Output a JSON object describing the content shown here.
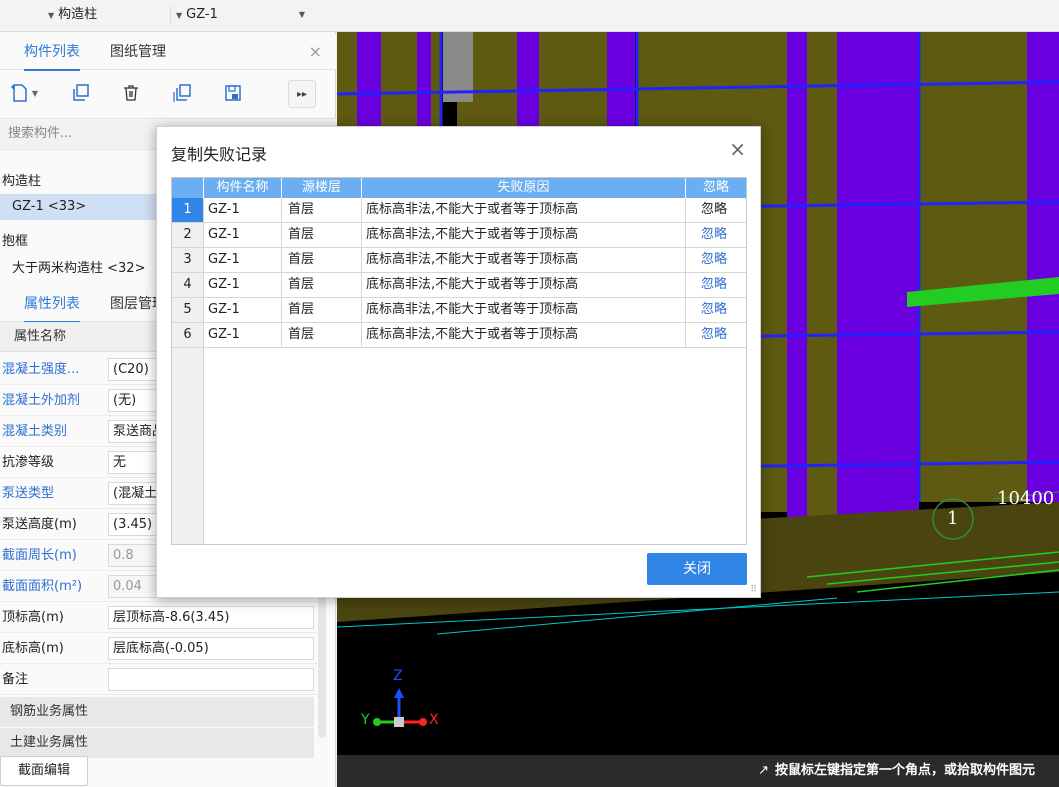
{
  "toolbar": {
    "combo1": "构造柱",
    "combo2": "GZ-1"
  },
  "left_tabs": {
    "tab1": "构件列表",
    "tab2": "图纸管理",
    "close": "×"
  },
  "search": {
    "placeholder": "搜索构件..."
  },
  "tree": {
    "group1": "构造柱",
    "item1": "GZ-1 <33>",
    "group2": "抱框",
    "item2": "大于两米构造柱 <32>"
  },
  "prop_tabs": {
    "tab1": "属性列表",
    "tab2": "图层管理"
  },
  "properties": {
    "header": "属性名称",
    "rows": [
      {
        "name": "混凝土强度...",
        "value": "(C20)"
      },
      {
        "name": "混凝土外加剂",
        "value": "(无)"
      },
      {
        "name": "混凝土类别",
        "value": "泵送商品砼"
      },
      {
        "name": "抗渗等级",
        "value": "无"
      },
      {
        "name": "泵送类型",
        "value": "(混凝土泵)"
      },
      {
        "name": "泵送高度(m)",
        "value": "(3.45)"
      },
      {
        "name": "截面周长(m)",
        "value": "0.8"
      },
      {
        "name": "截面面积(m²)",
        "value": "0.04"
      },
      {
        "name": "顶标高(m)",
        "value": "层顶标高-8.6(3.45)"
      },
      {
        "name": "底标高(m)",
        "value": "层底标高(-0.05)"
      },
      {
        "name": "备注",
        "value": ""
      }
    ],
    "group1": "钢筋业务属性",
    "group2": "土建业务属性"
  },
  "section_edit": "截面编辑",
  "viewport": {
    "label_10400": "10400",
    "label_1": "1",
    "axis_z": "Z",
    "axis_y": "Y",
    "axis_x": "X"
  },
  "status": {
    "icon": "↗",
    "text": "按鼠标左键指定第一个角点，或拾取构件图元"
  },
  "dialog": {
    "title": "复制失败记录",
    "close": "×",
    "columns": [
      "构件名称",
      "源楼层",
      "失败原因",
      "忽略"
    ],
    "rows": [
      {
        "num": "1",
        "name": "GZ-1",
        "floor": "首层",
        "reason": "底标高非法,不能大于或者等于顶标高",
        "ignore": "忽略"
      },
      {
        "num": "2",
        "name": "GZ-1",
        "floor": "首层",
        "reason": "底标高非法,不能大于或者等于顶标高",
        "ignore": "忽略"
      },
      {
        "num": "3",
        "name": "GZ-1",
        "floor": "首层",
        "reason": "底标高非法,不能大于或者等于顶标高",
        "ignore": "忽略"
      },
      {
        "num": "4",
        "name": "GZ-1",
        "floor": "首层",
        "reason": "底标高非法,不能大于或者等于顶标高",
        "ignore": "忽略"
      },
      {
        "num": "5",
        "name": "GZ-1",
        "floor": "首层",
        "reason": "底标高非法,不能大于或者等于顶标高",
        "ignore": "忽略"
      },
      {
        "num": "6",
        "name": "GZ-1",
        "floor": "首层",
        "reason": "底标高非法,不能大于或者等于顶标高",
        "ignore": "忽略"
      }
    ],
    "close_button": "关闭"
  },
  "colors": {
    "accent": "#2f86e6",
    "header_blue": "#6baef2",
    "link_blue": "#2f6fd0",
    "olive": "#6b6600",
    "purple": "#6a00e0",
    "blue_frame": "#2222ff",
    "green": "#22cc22"
  }
}
